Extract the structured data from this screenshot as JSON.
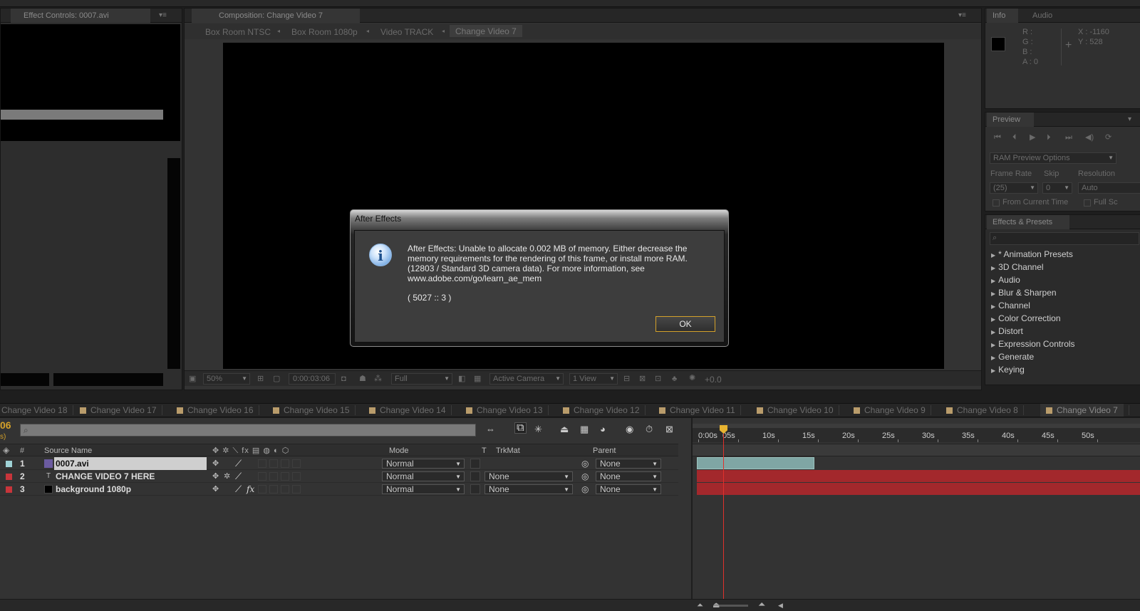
{
  "app": "After Effects",
  "effect_controls": {
    "tab": "Effect Controls: 0007.avi"
  },
  "composition": {
    "tab": "Composition: Change Video 7",
    "breadcrumbs": [
      "Box Room NTSC",
      "Box Room 1080p",
      "Video TRACK",
      "Change Video 7"
    ],
    "footer": {
      "zoom": "50%",
      "timecode": "0:00:03:06",
      "resolution": "Full",
      "camera": "Active Camera",
      "view": "1 View",
      "exposure": "+0.0"
    }
  },
  "info": {
    "tabs": [
      "Info",
      "Audio"
    ],
    "labels": [
      "R :",
      "G :",
      "B :",
      "A : 0"
    ],
    "x": "X : -1160",
    "y": "Y : 528"
  },
  "preview": {
    "tab": "Preview",
    "options": "RAM Preview Options",
    "frame_rate_label": "Frame Rate",
    "frame_rate_value": "(25)",
    "skip_label": "Skip",
    "skip_value": "0",
    "resolution_label": "Resolution",
    "resolution_value": "Auto",
    "from_current": "From Current Time",
    "full_screen": "Full Sc"
  },
  "effects_presets": {
    "tab": "Effects & Presets",
    "items": [
      "* Animation Presets",
      "3D Channel",
      "Audio",
      "Blur & Sharpen",
      "Channel",
      "Color Correction",
      "Distort",
      "Expression Controls",
      "Generate",
      "Keying"
    ]
  },
  "dialog": {
    "title": "After Effects",
    "line1": "After Effects: Unable to allocate 0.002 MB of memory. Either decrease the",
    "line2": "memory requirements for the rendering of this frame, or install more RAM.",
    "line3": "(12803 / Standard 3D camera data). For more information, see",
    "line4": "www.adobe.com/go/learn_ae_mem",
    "code": "( 5027 :: 3 )",
    "ok": "OK"
  },
  "timeline_tabs": [
    "Change Video 18",
    "Change Video 17",
    "Change Video 16",
    "Change Video 15",
    "Change Video 14",
    "Change Video 13",
    "Change Video 12",
    "Change Video 11",
    "Change Video 10",
    "Change Video 9",
    "Change Video 8",
    "Change Video 7"
  ],
  "timeline": {
    "time_fragment": "06",
    "time_fragment2": "s)",
    "headers": {
      "num": "#",
      "source": "Source Name",
      "mode": "Mode",
      "t": "T",
      "trkmat": "TrkMat",
      "parent": "Parent"
    },
    "switch_header_icons": "✥ ✲ ⟍ fx ▤ ◍ ◐ ⬡",
    "layers": [
      {
        "num": "1",
        "name": "0007.avi",
        "mode": "Normal",
        "trkmat": "",
        "parent": "None",
        "color": "#9fd2d6",
        "selected": true
      },
      {
        "num": "2",
        "name": "CHANGE VIDEO 7 HERE",
        "mode": "Normal",
        "trkmat": "None",
        "parent": "None",
        "color": "#c8353b",
        "selected": false
      },
      {
        "num": "3",
        "name": "background 1080p",
        "mode": "Normal",
        "trkmat": "None",
        "parent": "None",
        "color": "#c8353b",
        "selected": false
      }
    ],
    "fx_glyph": "fx",
    "ruler": [
      "0:00s",
      "05s",
      "10s",
      "15s",
      "20s",
      "25s",
      "30s",
      "35s",
      "40s",
      "45s",
      "50s"
    ]
  },
  "colors": {
    "accent": "#d4a12a",
    "label_red": "#c8353b",
    "label_aqua": "#9fd2d6",
    "playhead": "#e0312c"
  }
}
